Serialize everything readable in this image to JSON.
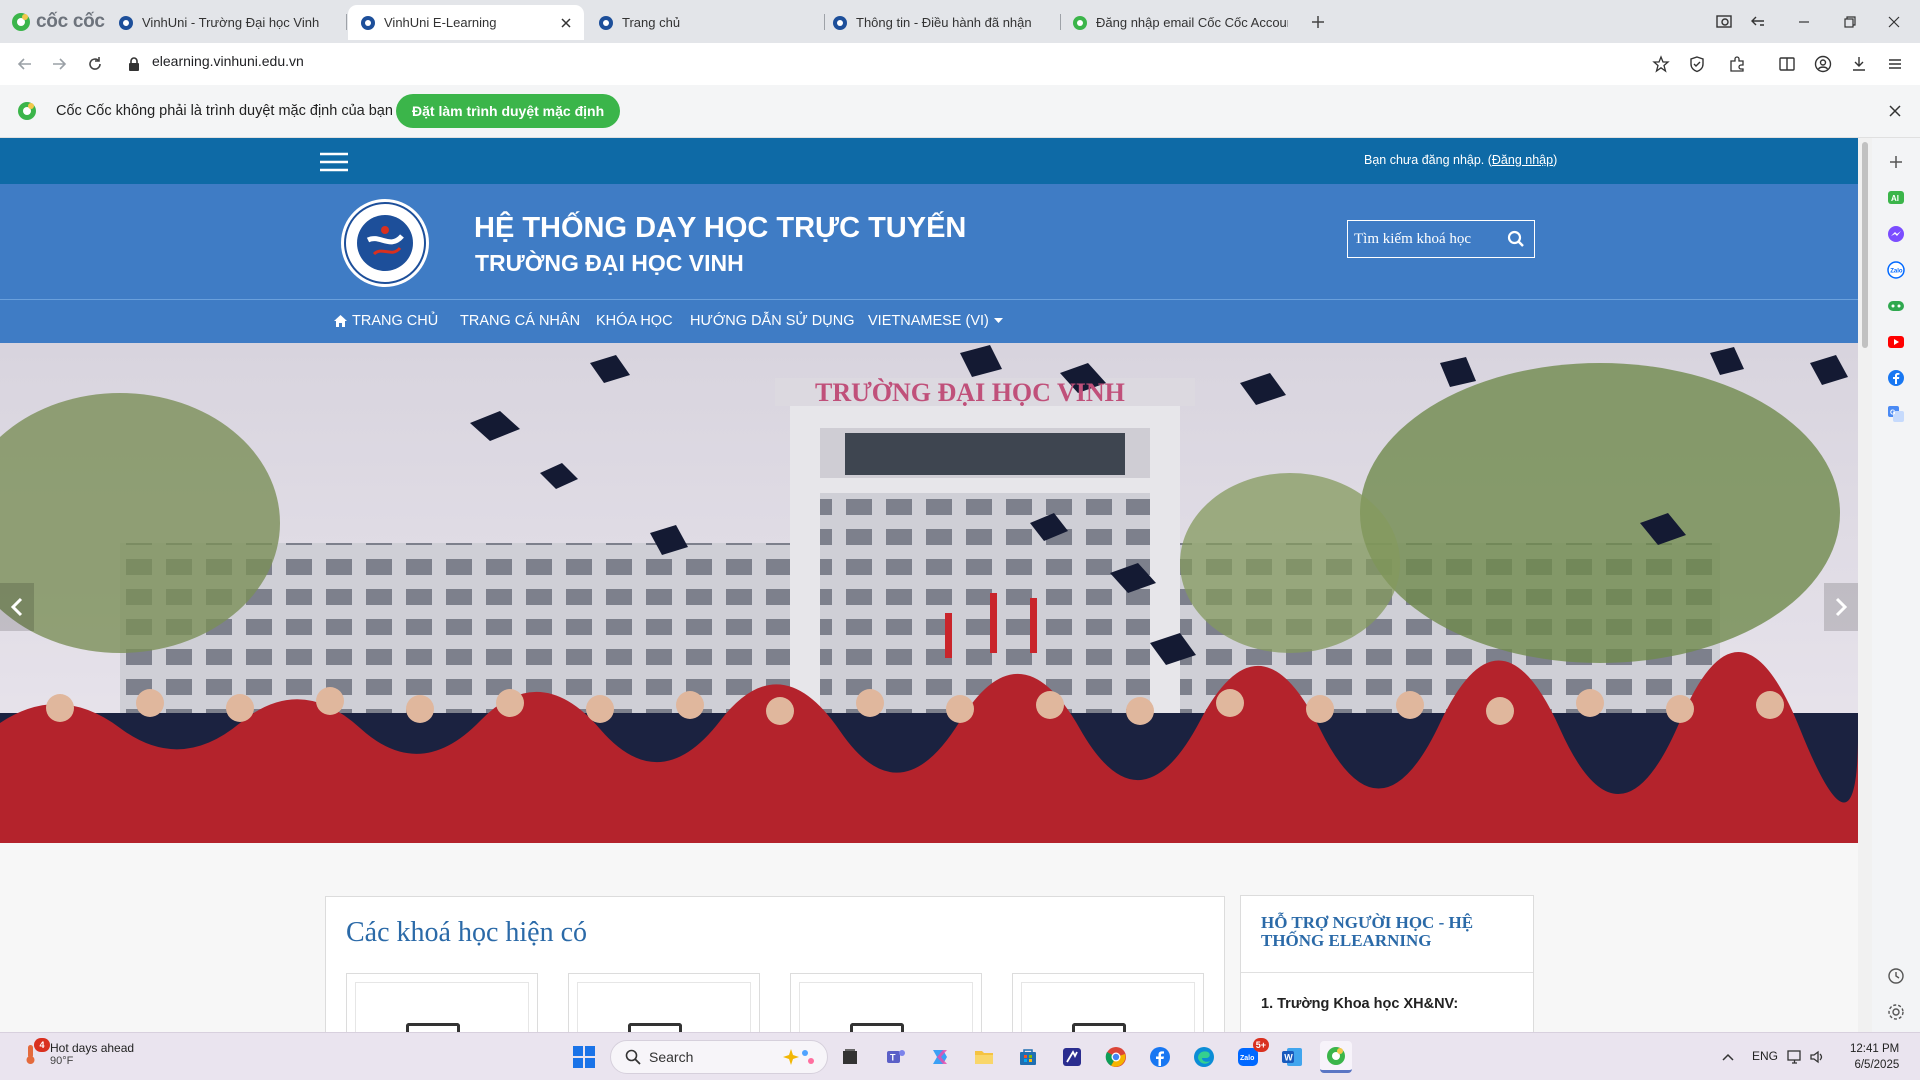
{
  "browser": {
    "brand": "cốc cốc",
    "tabs": [
      {
        "title": "VinhUni - Trường Đại học Vinh",
        "active": false
      },
      {
        "title": "VinhUni E-Learning",
        "active": true
      },
      {
        "title": "Trang chủ",
        "active": false
      },
      {
        "title": "Thông tin - Điều hành đã nhận",
        "active": false
      },
      {
        "title": "Đăng nhập email Cốc Cốc Accoun",
        "active": false
      }
    ],
    "url": "elearning.vinhuni.edu.vn"
  },
  "infobar": {
    "message": "Cốc Cốc không phải là trình duyệt mặc định của bạn",
    "button": "Đặt làm trình duyệt mặc định"
  },
  "site": {
    "login_text": "Bạn chưa đăng nhập. (",
    "login_link": "Đăng nhập",
    "login_close": ")",
    "title": "HỆ THỐNG DẠY HỌC TRỰC TUYẾN",
    "subtitle": "TRƯỜNG ĐẠI HỌC VINH",
    "search_placeholder": "Tìm kiếm khoá học",
    "nav": [
      {
        "label": "TRANG CHỦ"
      },
      {
        "label": "TRANG CÁ NHÂN"
      },
      {
        "label": "KHÓA HỌC"
      },
      {
        "label": "HƯỚNG DẪN SỬ DỤNG"
      },
      {
        "label": "VIETNAMESE (VI)"
      }
    ],
    "banner_sign": "TRƯỜNG ĐẠI HỌC VINH",
    "courses_title": "Các khoá học hiện có",
    "support_title": "HỖ TRỢ NGƯỜI HỌC - HỆ THỐNG ELEARNING",
    "support_item": "1. Trường Khoa học XH&NV:"
  },
  "taskbar": {
    "weather_title": "Hot days ahead",
    "weather_temp": "90°F",
    "weather_badge": "4",
    "search": "Search",
    "zalo_badge": "5+",
    "lang": "ENG",
    "time": "12:41 PM",
    "date": "6/5/2025"
  },
  "colors": {
    "header_blue": "#3f7cc5",
    "topstrip_blue": "#0e6aa6",
    "accent_green": "#3bb54a",
    "title_blue": "#2b6aa8"
  }
}
